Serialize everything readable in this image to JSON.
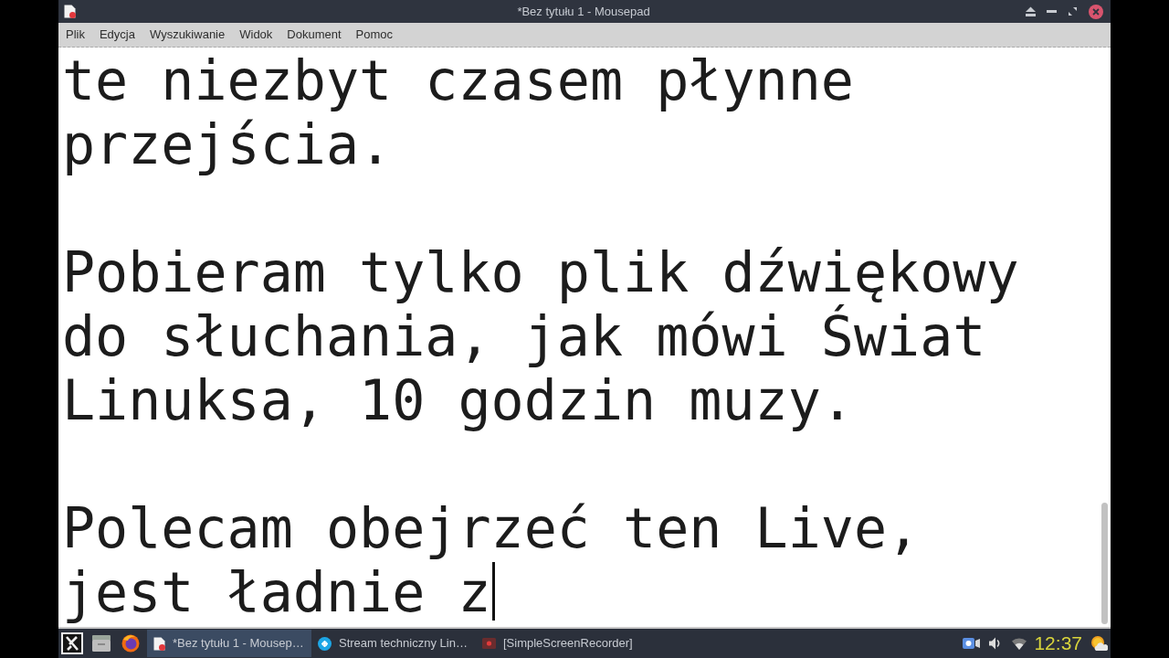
{
  "window": {
    "title": "*Bez tytułu 1 - Mousepad"
  },
  "menu": [
    "Plik",
    "Edycja",
    "Wyszukiwanie",
    "Widok",
    "Dokument",
    "Pomoc"
  ],
  "editor": {
    "paragraphs": [
      {
        "lines": [
          "te niezbyt czasem płynne",
          "przejścia."
        ]
      },
      {
        "lines": [
          "Pobieram tylko plik dźwiękowy",
          "do słuchania, jak mówi Świat",
          "Linuksa, 10 godzin muzy."
        ]
      },
      {
        "lines": [
          "Polecam obejrzeć ten Live,",
          "jest ładnie z"
        ]
      }
    ]
  },
  "taskbar": {
    "tasks": [
      {
        "kind": "document",
        "label": "*Bez tytułu 1 - Mousep…",
        "selected": true
      },
      {
        "kind": "stream",
        "label": "Stream techniczny Lin…",
        "selected": false
      },
      {
        "kind": "recorder",
        "label": "[SimpleScreenRecorder]",
        "selected": false
      }
    ],
    "clock": "12:37"
  }
}
